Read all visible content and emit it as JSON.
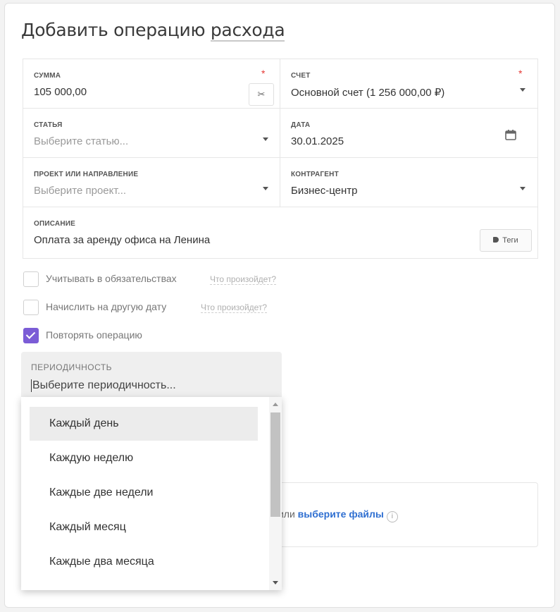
{
  "form": {
    "title_part1": "Добавить операцию ",
    "title_part2": "расхода",
    "sum": {
      "label": "СУММА",
      "value": "105 000,00",
      "required": "*"
    },
    "account": {
      "label": "СЧЕТ",
      "value": "Основной счет (1 256 000,00 ₽)",
      "required": "*"
    },
    "article": {
      "label": "СТАТЬЯ",
      "placeholder": "Выберите статью..."
    },
    "date": {
      "label": "ДАТА",
      "value": "30.01.2025"
    },
    "project": {
      "label": "ПРОЕКТ ИЛИ НАПРАВЛЕНИЕ",
      "placeholder": "Выберите проект..."
    },
    "counterparty": {
      "label": "КОНТРАГЕНТ",
      "value": "Бизнес-центр"
    },
    "description": {
      "label": "ОПИСАНИЕ",
      "value": "Оплата за аренду офиса на Ленина",
      "tags_button": "Теги"
    },
    "calc_symbol": "✂"
  },
  "options": {
    "obligations": {
      "label": "Учитывать в обязательствах",
      "hint": "Что произойдет?",
      "checked": false
    },
    "other_date": {
      "label": "Начислить на другую дату",
      "hint": "Что произойдет?",
      "checked": false
    },
    "repeat": {
      "label": "Повторять операцию",
      "checked": true
    }
  },
  "periodicity": {
    "label": "ПЕРИОДИЧНОСТЬ",
    "placeholder": "Выберите периодичность...",
    "items": [
      "Каждый день",
      "Каждую неделю",
      "Каждые две недели",
      "Каждый месяц",
      "Каждые два месяца"
    ],
    "highlighted_index": 0
  },
  "upload": {
    "text_before": "ы или ",
    "link": "выберите файлы",
    "info": "i"
  },
  "colors": {
    "accent": "#7b5cd6",
    "link": "#2f6fd1",
    "required": "#e53935"
  }
}
